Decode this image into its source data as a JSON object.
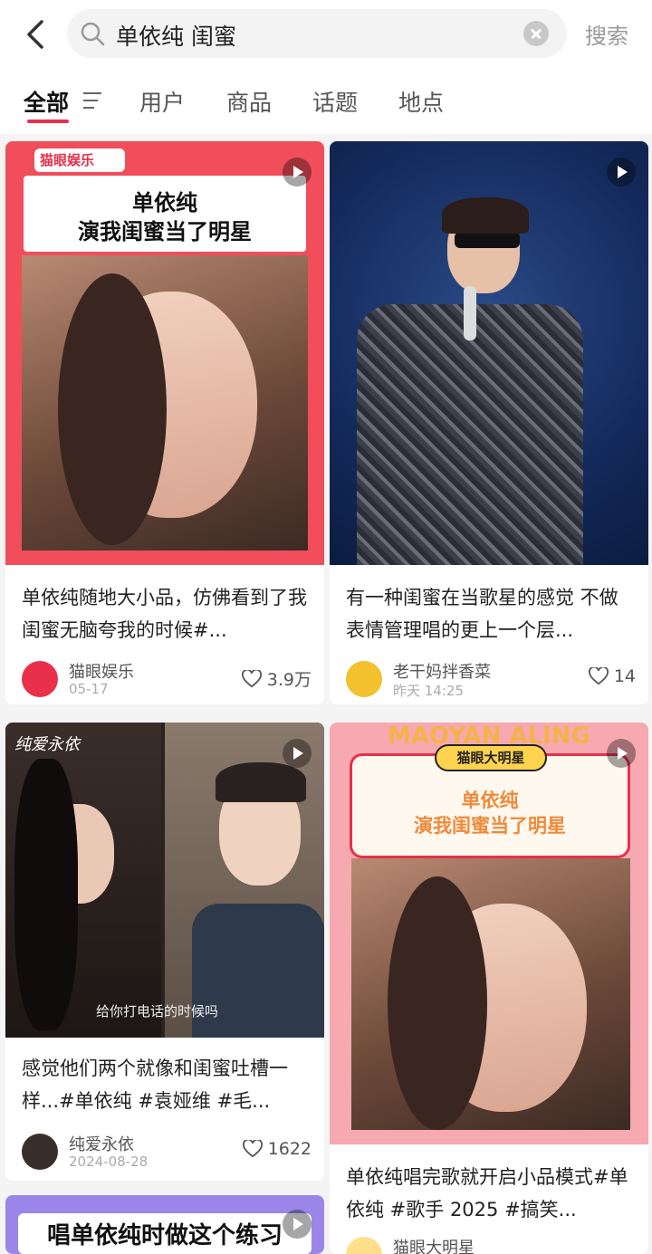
{
  "search": {
    "query": "单依纯 闺蜜",
    "button": "搜索"
  },
  "tabs": [
    {
      "label": "全部"
    },
    {
      "label": "用户"
    },
    {
      "label": "商品"
    },
    {
      "label": "话题"
    },
    {
      "label": "地点"
    }
  ],
  "posts": [
    {
      "badge": "猫眼娱乐",
      "overlay_line1": "单依纯",
      "overlay_line2": "演我闺蜜当了明星",
      "title": "单依纯随地大小品，仿佛看到了我闺蜜无脑夸我的时候#...",
      "author": "猫眼娱乐",
      "date": "05-17",
      "likes": "3.9万"
    },
    {
      "title": "有一种闺蜜在当歌星的感觉 不做表情管理唱的更上一个层...",
      "author": "老干妈拌香菜",
      "date": "昨天 14:25",
      "likes": "14"
    },
    {
      "watermark": "纯爱永依",
      "subtitle": "给你打电话的时候吗",
      "title": "感觉他们两个就像和闺蜜吐槽一样...#单依纯 #袁娅维 #毛...",
      "author": "纯爱永依",
      "date": "2024-08-28",
      "likes": "1622"
    },
    {
      "top_banner": "MAOYAN ALING",
      "badge": "猫眼大明星",
      "overlay_line1": "单依纯",
      "overlay_line2": "演我闺蜜当了明星",
      "title": "单依纯唱完歌就开启小品模式#单依纯 #歌手 2025 #搞笑...",
      "author": "猫眼大明星"
    },
    {
      "overlay": "唱单依纯时做这个练习"
    }
  ],
  "colors": {
    "accent": "#e8304a"
  }
}
